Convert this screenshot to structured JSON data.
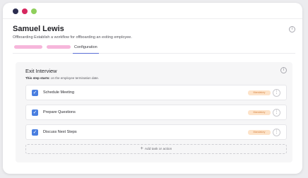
{
  "window": {
    "controls": [
      {
        "name": "close",
        "color": "#2b2d4f"
      },
      {
        "name": "minimize",
        "color": "#d6275f"
      },
      {
        "name": "maximize",
        "color": "#8fcf5c"
      }
    ]
  },
  "header": {
    "title": "Samuel Lewis",
    "subtitle": "Offboarding Establish a workflow for offboarding an exiting employee.",
    "info_icon": "i"
  },
  "tabs": {
    "placeholders": [
      {
        "color": "#f6b6db"
      },
      {
        "color": "#f6b6db"
      }
    ],
    "active_label": "Configuration",
    "accent": "#5b6fd6"
  },
  "panel": {
    "title": "Exit Interview",
    "desc_bold": "This step starts:",
    "desc_rest": " on the employee termination date.",
    "info_icon": "i",
    "tasks": [
      {
        "label": "Schedule Meeting",
        "badge": "Mandatory"
      },
      {
        "label": "Prepare Questions",
        "badge": "Mandatory"
      },
      {
        "label": "Discuss Next Steps",
        "badge": "Mandatory"
      }
    ],
    "task_more_icon": "⋮",
    "checkbox_color": "#4a7fe0",
    "badge_bg": "#fde3c9",
    "badge_fg": "#d9894a",
    "add_label": "Add task or action",
    "add_icon": "+"
  }
}
